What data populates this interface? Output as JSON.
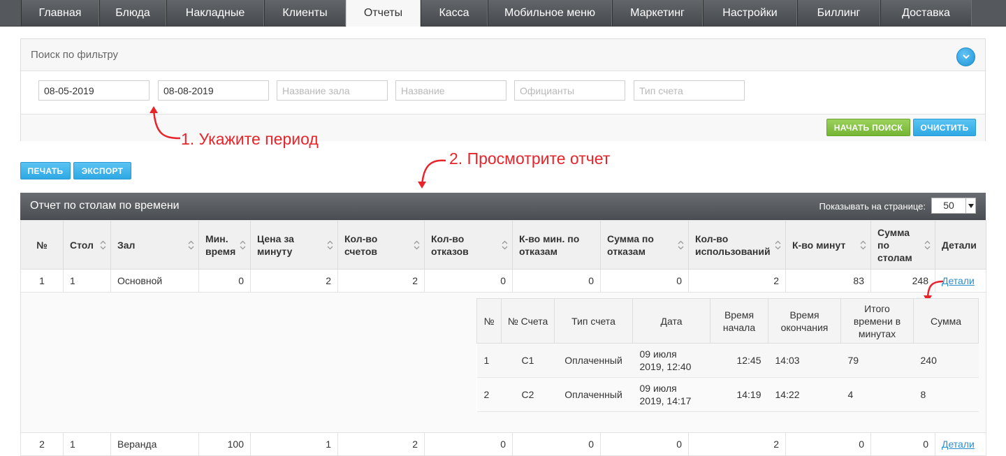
{
  "nav": {
    "tabs": [
      {
        "label": "Главная",
        "active": false
      },
      {
        "label": "Блюда",
        "active": false
      },
      {
        "label": "Накладные",
        "active": false
      },
      {
        "label": "Клиенты",
        "active": false
      },
      {
        "label": "Отчеты",
        "active": true
      },
      {
        "label": "Касса",
        "active": false
      },
      {
        "label": "Мобильное меню",
        "active": false
      },
      {
        "label": "Маркетинг",
        "active": false
      },
      {
        "label": "Настройки",
        "active": false
      },
      {
        "label": "Биллинг",
        "active": false
      },
      {
        "label": "Доставка",
        "active": false
      }
    ]
  },
  "filter": {
    "title": "Поиск по фильтру",
    "date_from": "08-05-2019",
    "date_to": "08-08-2019",
    "hall_placeholder": "Название зала",
    "name_placeholder": "Название",
    "waiters_placeholder": "Официанты",
    "bill_type_placeholder": "Тип счета",
    "search_label": "НАЧАТЬ ПОИСК",
    "clear_label": "ОЧИСТИТЬ"
  },
  "annotations": {
    "step1": "1. Укажите период",
    "step2": "2. Просмотрите отчет"
  },
  "actions": {
    "print_label": "ПЕЧАТЬ",
    "export_label": "ЭКСПОРТ"
  },
  "report": {
    "title": "Отчет по столам по времени",
    "per_page_label": "Показывать на странице:",
    "per_page_value": "50",
    "columns": [
      "№",
      "Стол",
      "Зал",
      "Мин. время",
      "Цена за минуту",
      "Кол-во счетов",
      "Кол-во отказов",
      "К-во мин. по отказам",
      "Сумма по отказам",
      "Кол-во использований",
      "К-во минут",
      "Сумма по столам",
      "Детали"
    ],
    "rows": [
      {
        "no": "1",
        "table": "1",
        "hall": "Основной",
        "min_time": "0",
        "price_per_min": "2",
        "bills": "2",
        "refusals": "0",
        "refusal_minutes": "0",
        "refusal_sum": "0",
        "uses": "2",
        "minutes": "83",
        "sum": "248",
        "details": "Детали"
      },
      {
        "no": "2",
        "table": "1",
        "hall": "Веранда",
        "min_time": "100",
        "price_per_min": "1",
        "bills": "2",
        "refusals": "0",
        "refusal_minutes": "0",
        "refusal_sum": "0",
        "uses": "2",
        "minutes": "0",
        "sum": "0",
        "details": "Детали"
      }
    ],
    "details": {
      "columns": [
        "№",
        "№ Счета",
        "Тип счета",
        "Дата",
        "Время начала",
        "Время окончания",
        "Итого времени в минутах",
        "Сумма"
      ],
      "rows": [
        {
          "no": "1",
          "bill_no": "C1",
          "bill_type": "Оплаченный",
          "date": "09 июля 2019, 12:40",
          "start": "12:45",
          "end": "14:03",
          "total_minutes": "79",
          "sum": "240"
        },
        {
          "no": "2",
          "bill_no": "C2",
          "bill_type": "Оплаченный",
          "date": "09 июля 2019, 14:17",
          "start": "14:19",
          "end": "14:22",
          "total_minutes": "4",
          "sum": "8"
        }
      ]
    }
  },
  "colors": {
    "annotation": "#e8242b",
    "link": "#2a8fce",
    "button_green": "#75b534",
    "button_blue": "#2ea8e4"
  }
}
